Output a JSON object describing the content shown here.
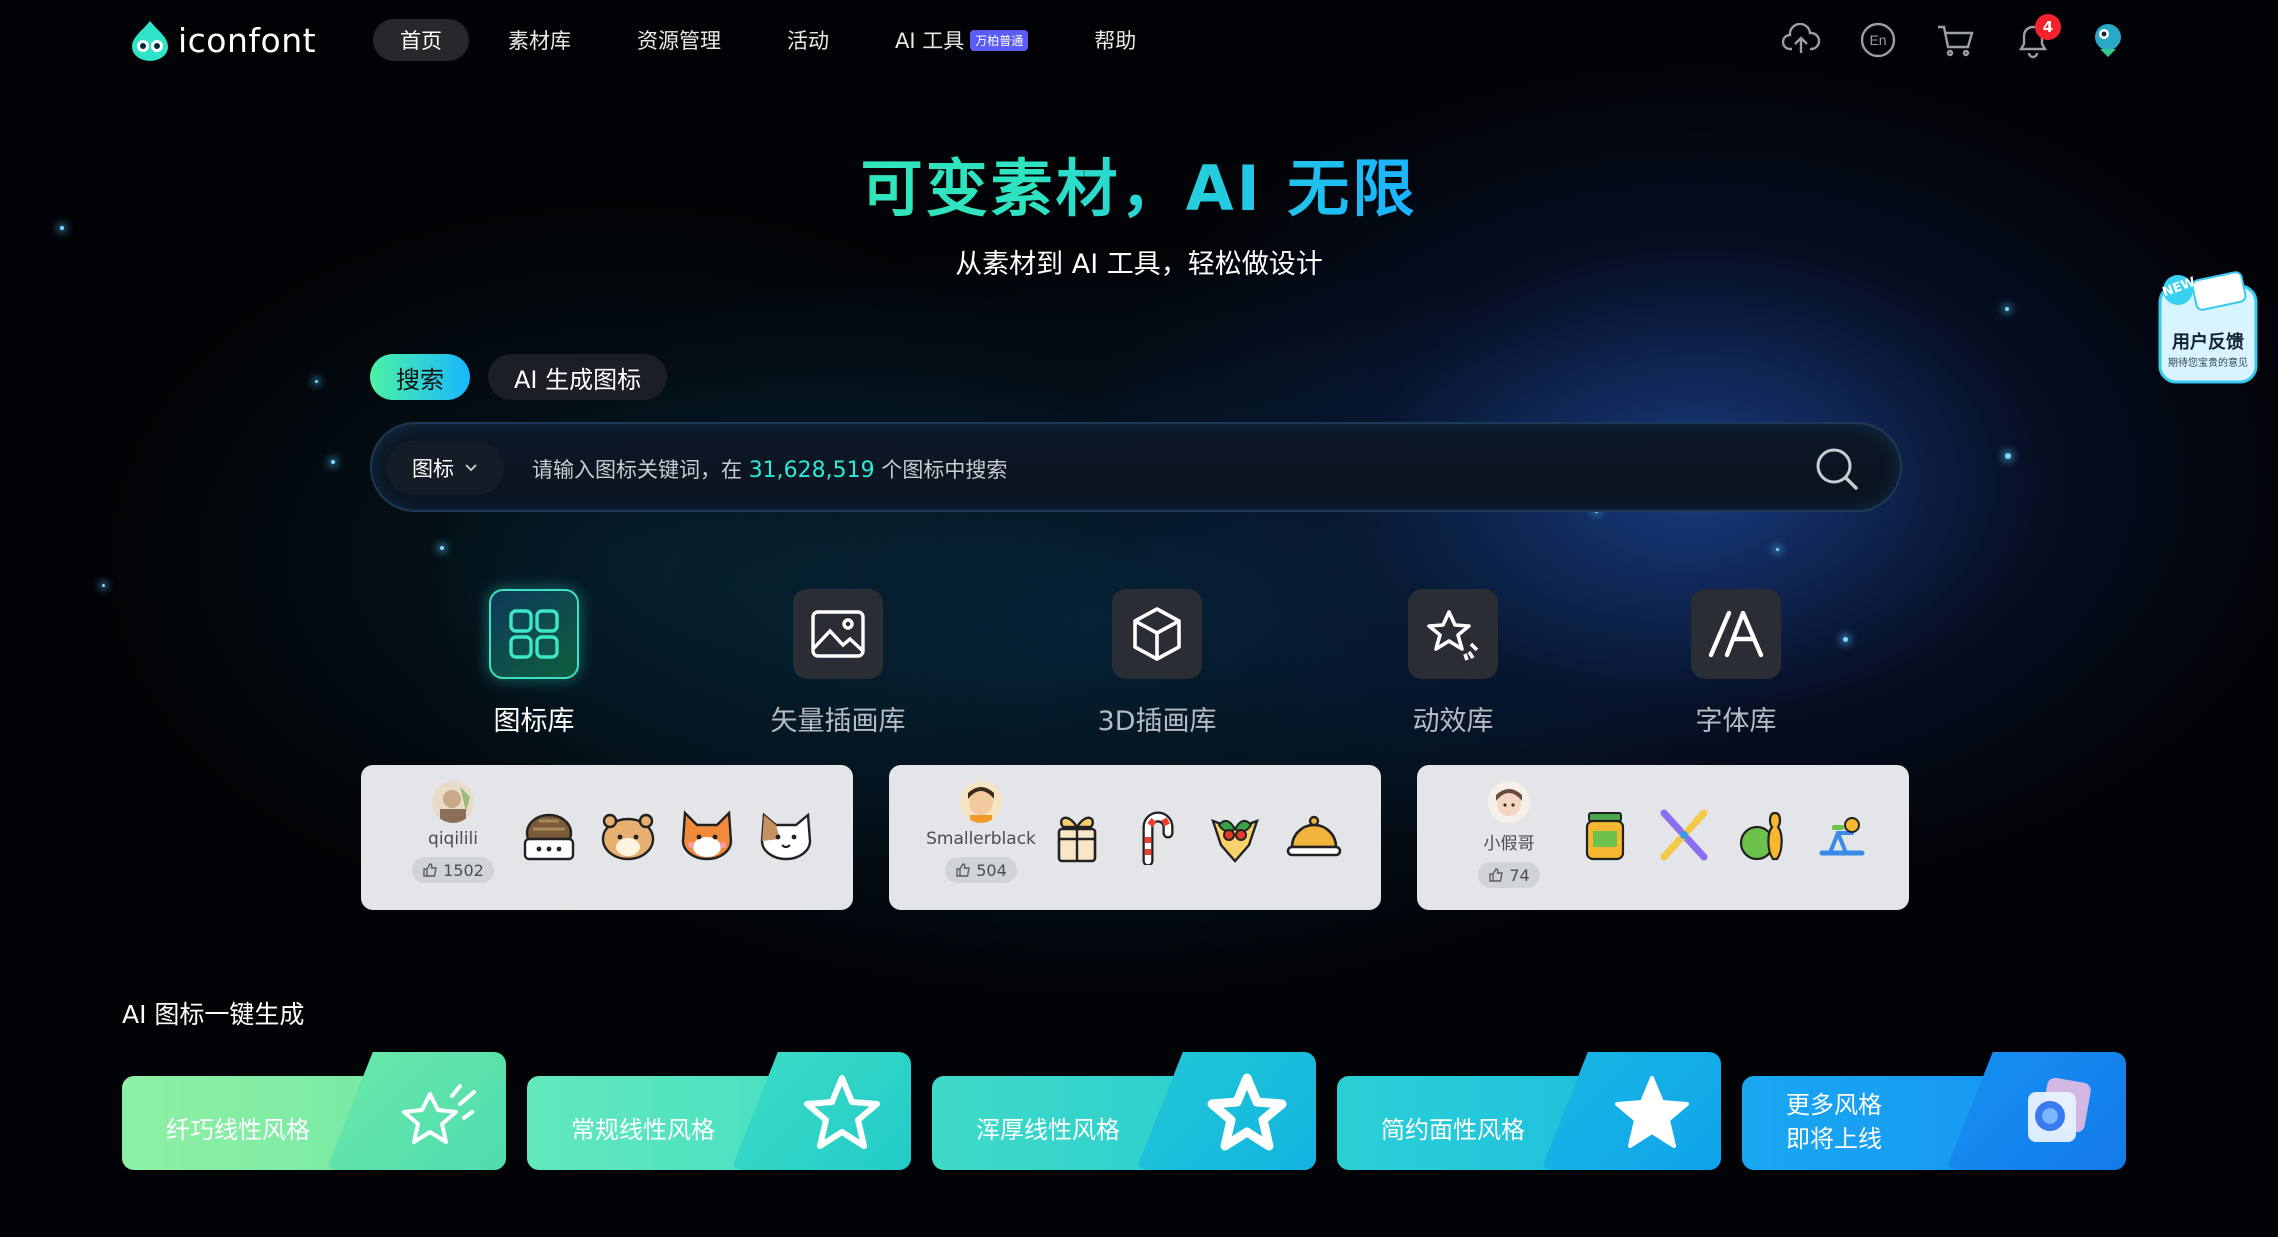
{
  "header": {
    "logo_text": "iconfont",
    "nav": [
      {
        "label": "首页",
        "active": true
      },
      {
        "label": "素材库"
      },
      {
        "label": "资源管理"
      },
      {
        "label": "活动"
      },
      {
        "label": "AI 工具",
        "badge": "万柏普通"
      },
      {
        "label": "帮助"
      }
    ],
    "notification_count": "4",
    "icons": [
      "upload-icon",
      "language-en-icon",
      "cart-icon",
      "bell-icon",
      "avatar"
    ]
  },
  "hero": {
    "title": "可变素材，AI 无限",
    "subtitle": "从素材到 AI 工具，轻松做设计"
  },
  "search": {
    "tabs": [
      "搜索",
      "AI 生成图标"
    ],
    "type_label": "图标",
    "placeholder_prefix": "请输入图标关键词，在",
    "placeholder_count": "31,628,519",
    "placeholder_suffix": "个图标中搜索"
  },
  "categories": [
    {
      "label": "图标库",
      "icon": "grid-icon",
      "active": true
    },
    {
      "label": "矢量插画库",
      "icon": "image-icon"
    },
    {
      "label": "3D插画库",
      "icon": "cube-icon"
    },
    {
      "label": "动效库",
      "icon": "sparkle-star-icon"
    },
    {
      "label": "字体库",
      "icon": "font-a-icon"
    }
  ],
  "showcase": [
    {
      "author": "qiqilili",
      "likes": "1502",
      "icons": [
        "turtle-icon",
        "hamster-icon",
        "shiba-icon",
        "cat-icon"
      ]
    },
    {
      "author": "Smallerblack",
      "likes": "504",
      "icons": [
        "gift-icon",
        "candy-cane-icon",
        "holly-icon",
        "cloche-icon"
      ]
    },
    {
      "author": "小假哥",
      "likes": "74",
      "icons": [
        "jar-icon",
        "crossed-bats-icon",
        "bowling-icon",
        "exercise-bike-icon"
      ]
    }
  ],
  "ai_section": {
    "title": "AI 图标一键生成",
    "cards": [
      {
        "label": "纤巧线性风格",
        "colors": [
          "#8ef0a4",
          "#5fe3a9"
        ]
      },
      {
        "label": "常规线性风格",
        "colors": [
          "#62e8bd",
          "#2fd8c3"
        ]
      },
      {
        "label": "浑厚线性风格",
        "colors": [
          "#3fdac7",
          "#1fc5d9"
        ]
      },
      {
        "label": "简约面性风格",
        "colors": [
          "#2bd0d6",
          "#12b0e6"
        ]
      },
      {
        "label_line1": "更多风格",
        "label_line2": "即将上线",
        "colors": [
          "#19a7f2",
          "#1587f0"
        ]
      }
    ]
  },
  "feedback": {
    "new_tag": "NEW",
    "title": "用户反馈",
    "subtitle": "期待您宝贵的意见"
  }
}
